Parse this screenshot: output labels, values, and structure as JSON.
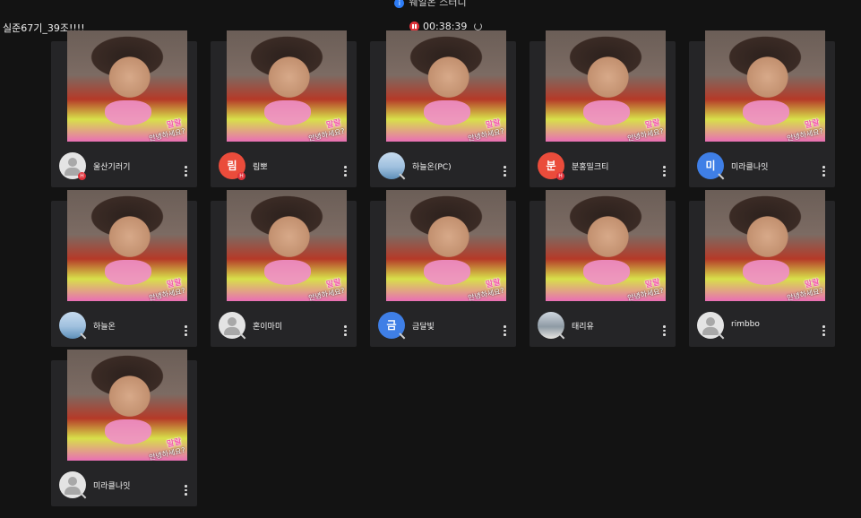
{
  "header": {
    "title": "웨일온 스터디",
    "room": "실준67기_39조!!!!",
    "timer": "00:38:39"
  },
  "photo": {
    "caption_main": "말랄",
    "caption_sub": "안녕하세요?"
  },
  "participants": [
    {
      "name": "울산기러기",
      "avatar": "gray"
    },
    {
      "name": "림뽀",
      "avatar": "red",
      "initial": "림"
    },
    {
      "name": "하늘온(PC)",
      "avatar": "sky"
    },
    {
      "name": "분홍밀크티",
      "avatar": "red",
      "initial": "분"
    },
    {
      "name": "미라클나잇",
      "avatar": "blue",
      "initial": "미"
    },
    {
      "name": "하늘온",
      "avatar": "sky"
    },
    {
      "name": "혼이마미",
      "avatar": "gray"
    },
    {
      "name": "금달빛",
      "avatar": "blue",
      "initial": "금"
    },
    {
      "name": "태리유",
      "avatar": "person"
    },
    {
      "name": "rimbbo",
      "avatar": "gray"
    },
    {
      "name": "미라클나잇",
      "avatar": "gray"
    }
  ]
}
